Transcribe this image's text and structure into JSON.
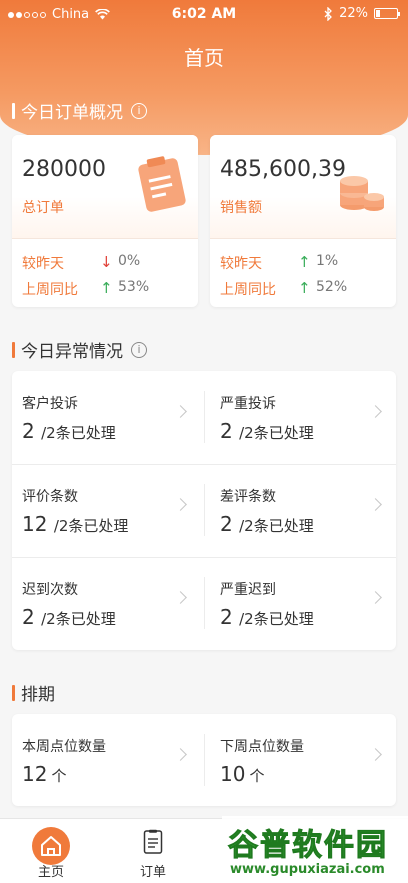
{
  "status_bar": {
    "carrier": "China",
    "time": "6:02 AM",
    "battery": "22%",
    "battery_level": 0.22
  },
  "nav": {
    "title": "首页"
  },
  "today_orders": {
    "title": "今日订单概况",
    "cards": [
      {
        "value": "280000",
        "label": "总订单",
        "vs_yesterday_label": "较昨天",
        "vs_yesterday_dir": "down",
        "vs_yesterday": "0%",
        "vs_lastweek_label": "上周同比",
        "vs_lastweek_dir": "up",
        "vs_lastweek": "53%"
      },
      {
        "value": "485,600,39",
        "label": "销售额",
        "vs_yesterday_label": "较昨天",
        "vs_yesterday_dir": "up",
        "vs_yesterday": "1%",
        "vs_lastweek_label": "上周同比",
        "vs_lastweek_dir": "up",
        "vs_lastweek": "52%"
      }
    ]
  },
  "anomalies": {
    "title": "今日异常情况",
    "items": [
      {
        "label": "客户投诉",
        "count": "2",
        "suffix": "/2条已处理"
      },
      {
        "label": "严重投诉",
        "count": "2",
        "suffix": "/2条已处理"
      },
      {
        "label": "评价条数",
        "count": "12",
        "suffix": "/2条已处理"
      },
      {
        "label": "差评条数",
        "count": "2",
        "suffix": "/2条已处理"
      },
      {
        "label": "迟到次数",
        "count": "2",
        "suffix": "/2条已处理"
      },
      {
        "label": "严重迟到",
        "count": "2",
        "suffix": "/2条已处理"
      }
    ]
  },
  "schedule": {
    "title": "排期",
    "items": [
      {
        "label": "本周点位数量",
        "count": "12",
        "unit": "个"
      },
      {
        "label": "下周点位数量",
        "count": "10",
        "unit": "个"
      }
    ]
  },
  "tabbar": {
    "home": "主页",
    "orders": "订单"
  },
  "watermark": {
    "title": "谷普软件园",
    "url": "www.gupuxiazai.com"
  },
  "colors": {
    "accent": "#f07a3b",
    "up": "#3cae5c",
    "down": "#e0423a",
    "watermark": "#3aa63a"
  }
}
